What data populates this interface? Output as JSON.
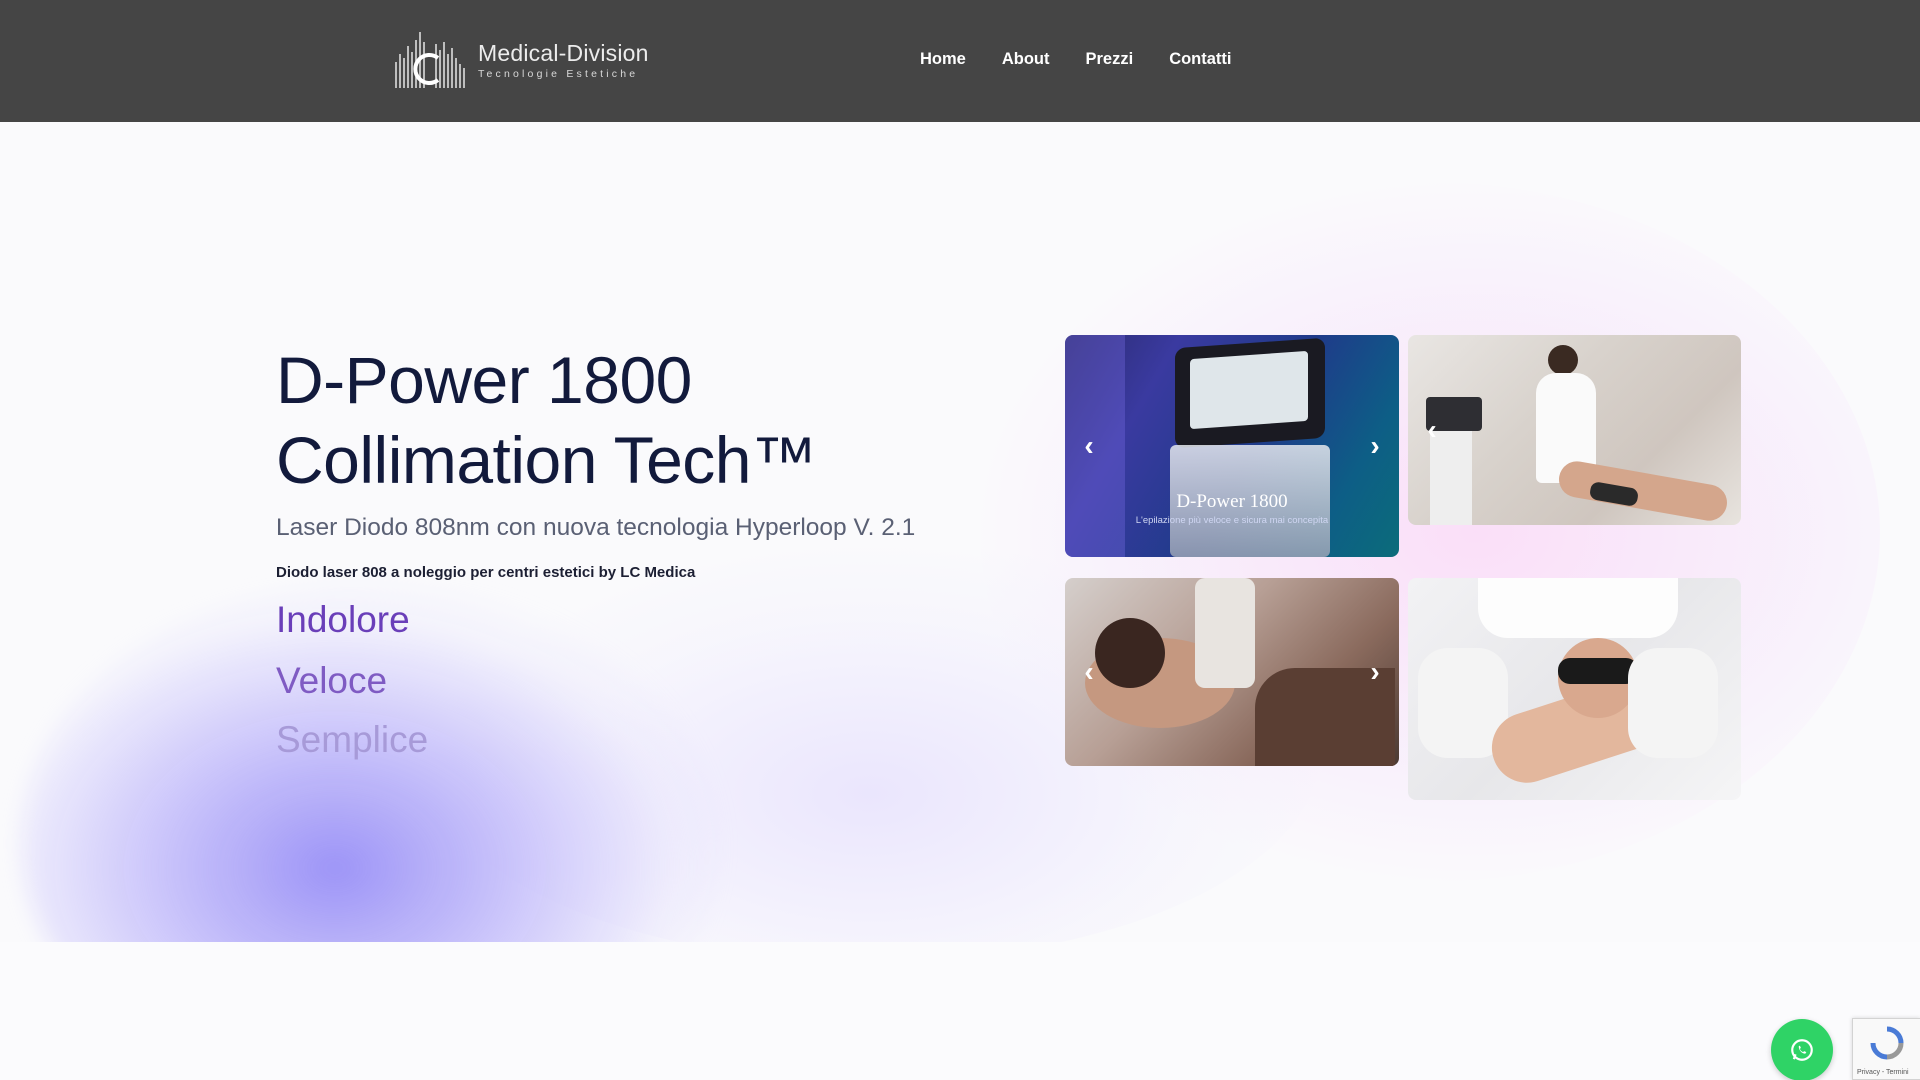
{
  "header": {
    "logo": {
      "name": "Medical-Division",
      "tagline": "Tecnologie Estetiche"
    },
    "nav": [
      "Home",
      "About",
      "Prezzi",
      "Contatti"
    ]
  },
  "hero": {
    "title_line1": "D-Power 1800",
    "title_line2": "Collimation Tech™",
    "subtitle": "Laser Diodo 808nm con nuova tecnologia Hyperloop V. 2.1",
    "subline": "Diodo laser 808 a noleggio per centri estetici by LC Medica",
    "features": [
      "Indolore",
      "Veloce",
      "Semplice"
    ]
  },
  "gallery": {
    "card1_caption_title": "D-Power 1800",
    "card1_caption_sub": "L'epilazione più veloce e sicura mai concepita",
    "prev_icon": "chevron-left-icon",
    "next_icon": "chevron-right-icon"
  },
  "widgets": {
    "whatsapp_icon": "whatsapp-icon",
    "recaptcha_text": "Privacy - Termini"
  },
  "colors": {
    "header_bg": "#454545",
    "title": "#121a3c",
    "feature_1": "#6a3fb9",
    "feature_2": "#7f5bc3",
    "feature_3": "#a79ad8",
    "whatsapp": "#2fd366"
  }
}
